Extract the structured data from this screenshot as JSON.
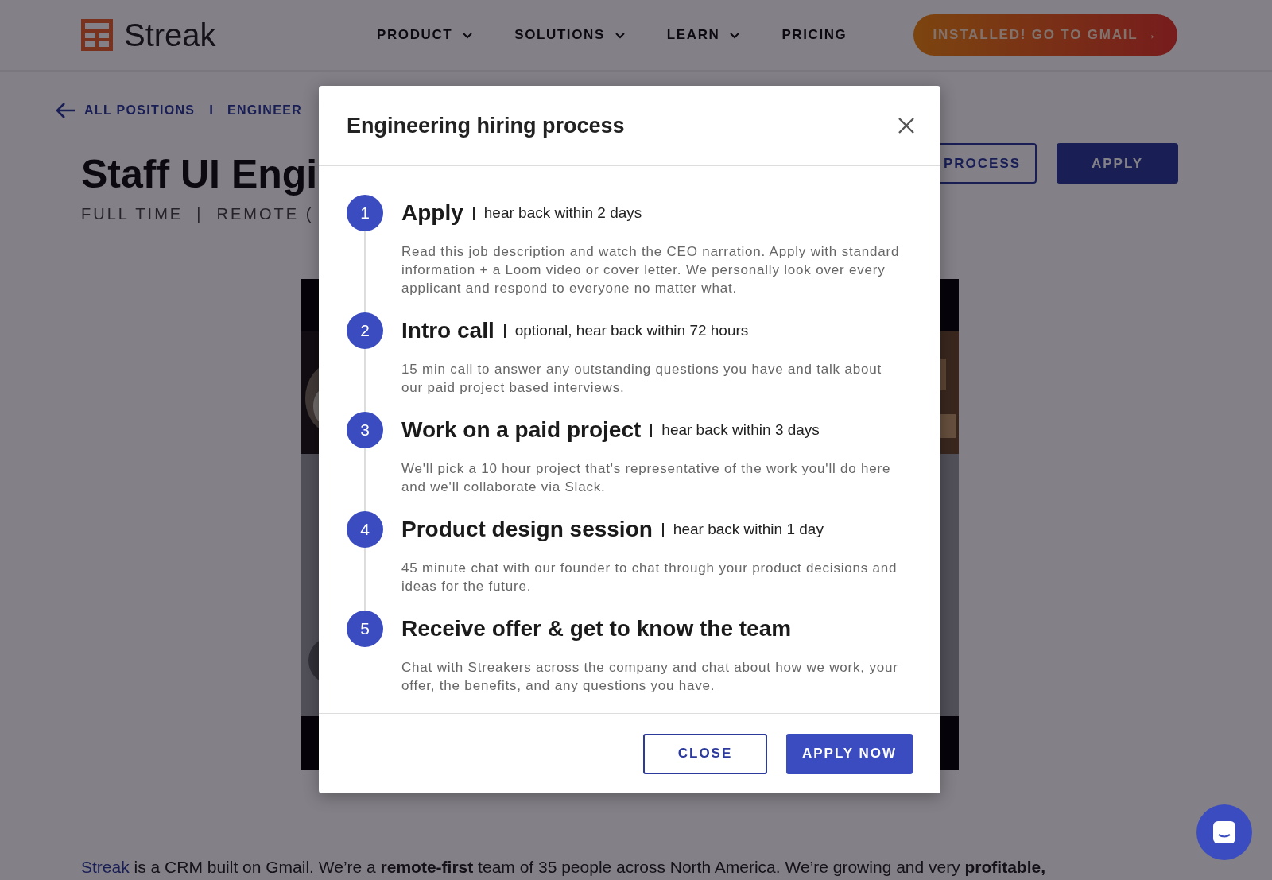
{
  "nav": {
    "logo": "Streak",
    "menu": [
      {
        "label": "PRODUCT",
        "dropdown": true
      },
      {
        "label": "SOLUTIONS",
        "dropdown": true
      },
      {
        "label": "LEARN",
        "dropdown": true
      },
      {
        "label": "PRICING",
        "dropdown": false
      }
    ],
    "cta": "INSTALLED! GO TO GMAIL →"
  },
  "breadcrumb": {
    "back": "ALL POSITIONS",
    "separator": "I",
    "current": "ENGINEER"
  },
  "job": {
    "title": "Staff UI Engi",
    "meta": "FULL TIME  |  REMOTE (",
    "process_button": "PROCESS",
    "apply_button": "APPLY"
  },
  "intro": {
    "link": "Streak",
    "text": " is a CRM built on Gmail. We’re a **remote-first** team of 35 people across North America. We’re growing and very **profitable,**"
  },
  "modal": {
    "title": "Engineering hiring process",
    "steps": [
      {
        "number": "1",
        "title": "Apply",
        "note": "hear back within 2 days",
        "description": "Read this job description and watch the CEO narration. Apply with standard information + a Loom video or cover letter. We personally look over every applicant and respond to everyone no matter what."
      },
      {
        "number": "2",
        "title": "Intro call",
        "note": "optional, hear back within 72 hours",
        "description": "15 min call to answer any outstanding questions you have and talk about our paid project based interviews."
      },
      {
        "number": "3",
        "title": "Work on a paid project",
        "note": "hear back within 3 days",
        "description": "We'll pick a 10 hour project that's representative of the work you'll do here and we'll collaborate via Slack."
      },
      {
        "number": "4",
        "title": "Product design session",
        "note": "hear back within 1 day",
        "description": "45 minute chat with our founder to chat through your product decisions and ideas for the future."
      },
      {
        "number": "5",
        "title": "Receive offer & get to know the team",
        "description": "Chat with Streakers across the company and chat about how we work, your offer, the benefits, and any questions you have."
      }
    ],
    "close_button": "CLOSE",
    "apply_button": "APPLY NOW"
  }
}
